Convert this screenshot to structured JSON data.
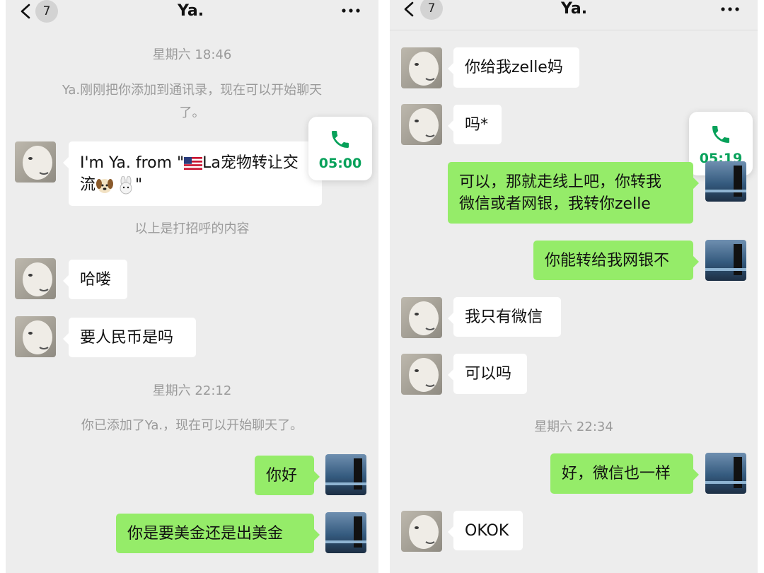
{
  "left": {
    "header": {
      "badge": "7",
      "title": "Ya."
    },
    "messages": {
      "ts1": "星期六 18:46",
      "sys1_l1": "Ya.刚刚把你添加到通讯录，现在可以开始聊天",
      "sys1_l2": "了。",
      "intro_l1_a": "I'm Ya. from \"",
      "intro_l1_b": "La宠物转让交",
      "intro_l2_a": "流",
      "intro_l2_b": "\"",
      "greeting_note": "以上是打招呼的内容",
      "msg_hello": "哈喽",
      "msg_rmb": "要人民币是吗",
      "ts2": "星期六 22:12",
      "sys2": "你已添加了Ya.，现在可以开始聊天了。",
      "msg_nihao": "你好",
      "msg_usd": "你是要美金还是出美金"
    },
    "call_time": "05:00"
  },
  "right": {
    "header": {
      "badge": "7",
      "title": "Ya."
    },
    "messages": {
      "msg_zelle": "你给我zelle妈",
      "msg_ma": "吗*",
      "msg_online_l1": "可以，那就走线上吧，你转我",
      "msg_online_l2": "微信或者网银，我转你zelle",
      "msg_bank": "你能转给我网银不",
      "msg_wechat_only": "我只有微信",
      "msg_ok": "可以吗",
      "ts3": "星期六 22:34",
      "msg_same": "好，微信也一样",
      "msg_okok": "OKOK"
    },
    "call_time": "05:19"
  },
  "icons": {
    "back": "chevron-left-icon",
    "more": "more-dots-icon",
    "call": "phone-icon",
    "flag": "us-flag-icon",
    "dog": "dog-face-icon",
    "rabbit": "rabbit-face-icon"
  },
  "colors": {
    "background": "#ededed",
    "outgoing_bubble": "#95ec69",
    "incoming_bubble": "#ffffff",
    "call_green": "#07a15a",
    "system_text": "#9a9a9a"
  }
}
